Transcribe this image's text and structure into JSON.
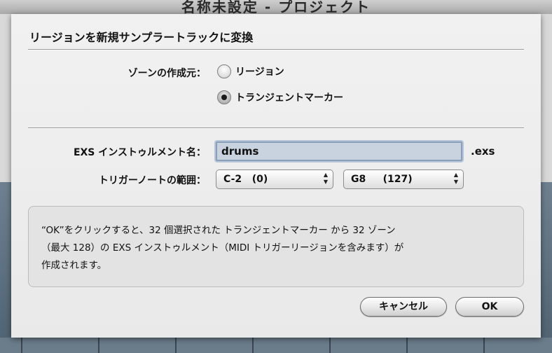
{
  "dialog": {
    "title": "リージョンを新規サンプラートラックに変換",
    "zone_source": {
      "label": "ゾーンの作成元：",
      "options": [
        {
          "label": "リージョン",
          "selected": false
        },
        {
          "label": "トランジェントマーカー",
          "selected": true
        }
      ]
    },
    "instrument_name": {
      "label": "EXS インストゥルメント名：",
      "value": "drums",
      "suffix": ".exs"
    },
    "trigger_range": {
      "label": "トリガーノートの範囲：",
      "low": "C-2   (0)",
      "high": "G8     (127)"
    },
    "info": {
      "lines": [
        "“OK”をクリックすると、32 個選択された トランジェントマーカー から 32 ゾーン",
        "（最大 128）の EXS インストゥルメント（MIDI トリガーリージョンを含みます）が",
        "作成されます。"
      ]
    },
    "buttons": {
      "cancel": "キャンセル",
      "ok": "OK"
    }
  },
  "background_window": {
    "title": "名称未設定 - プロジェクト"
  }
}
